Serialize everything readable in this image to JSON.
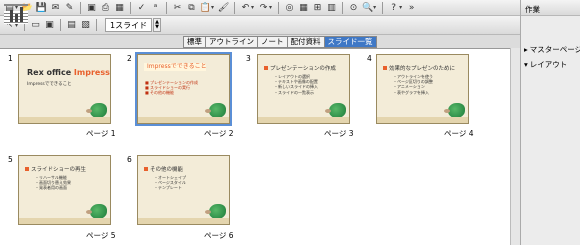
{
  "toolbar": {
    "slide_label": "1スライド"
  },
  "tabs": [
    "標準",
    "アウトライン",
    "ノート",
    "配付資料",
    "スライド一覧"
  ],
  "slides": [
    {
      "num": "1",
      "caption": "ページ 1",
      "title_a": "Rex office ",
      "title_b": "Impress",
      "subtitle": "Impressでできること"
    },
    {
      "num": "2",
      "caption": "ページ 2",
      "title": "Impressでできること",
      "bullets": [
        "■ プレゼンテーションの作成",
        "■ スライドショーの実行",
        "■ その他の機能"
      ]
    },
    {
      "num": "3",
      "caption": "ページ 3",
      "title": "プレゼンテーションの作成",
      "bullets": [
        "・レイアウトの選択",
        "・テキストや画像の配置",
        "・新しいスライドの挿入",
        "・スライドの一覧表示"
      ]
    },
    {
      "num": "4",
      "caption": "ページ 4",
      "title": "効果的なプレゼンのために",
      "bullets": [
        "・アウトラインを使う",
        "・ページ区切りの調整",
        "・アニメーション",
        "・表やグラフを挿入"
      ]
    },
    {
      "num": "5",
      "caption": "ページ 5",
      "title": "スライドショーの再生",
      "bullets": [
        "・リハーサル機能",
        "・画面切り替え効果",
        "・発表者用の画面"
      ]
    },
    {
      "num": "6",
      "caption": "ページ 6",
      "title": "その他の機能",
      "bullets": [
        "・オートシェイプ",
        "・ページスタイル",
        "・テンプレート"
      ]
    }
  ],
  "panel": {
    "title": "作業",
    "master": "マスターページ",
    "layout": "レイアウト"
  }
}
